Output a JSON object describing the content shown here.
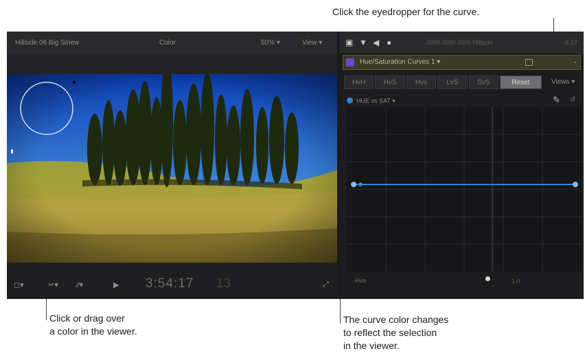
{
  "annotations": {
    "top": "Click the eyedropper for the curve.",
    "viewer_line1": "Click or drag over",
    "viewer_line2": "a color in the viewer.",
    "curve_line1": "The curve color changes",
    "curve_line2": "to reflect the selection",
    "curve_line3": "in the viewer."
  },
  "viewer": {
    "title": "Hillside 06 Big Sinew",
    "color_label": "Color",
    "zoom": "50%",
    "view_menu": "View",
    "timecode": "3:54:17",
    "timecode_frames": "13",
    "bottom_controls": [
      "◻▾",
      "✂▾",
      "⁄⁄▾",
      "▶"
    ]
  },
  "inspector": {
    "header_icons": [
      "film-icon",
      "filter-icon",
      "speaker-icon",
      "info-icon"
    ],
    "header_title": "0000 0000 0000 Hillside",
    "header_right": "8:17",
    "effect_name": "Hue/Saturation Curves 1",
    "effect_color": "#6d4ac9",
    "tabs": [
      "HvH",
      "HvS",
      "Hvs",
      "LvS",
      "SvS",
      "Reset"
    ],
    "active_tab": 5,
    "view_menu": "Views",
    "curve_name": "HUE vs SAT",
    "curve_color": "#2d83d6",
    "scrub_label": "Hue",
    "scrub_right": "1.0"
  }
}
